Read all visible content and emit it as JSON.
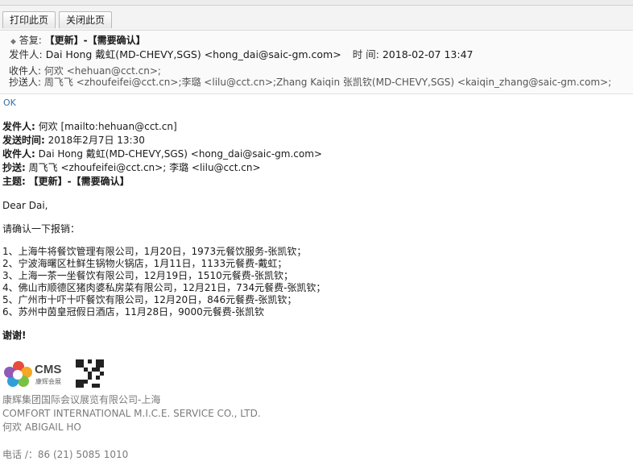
{
  "toolbar": {
    "print_label": "打印此页",
    "close_label": "关闭此页"
  },
  "header": {
    "subject_label": "答复:",
    "subject_value": "【更新】-【需要确认】",
    "from_label": "发件人:",
    "from_value": "Dai Hong 戴虹(MD-CHEVY,SGS) <hong_dai@saic-gm.com>",
    "time_label": "时 间:",
    "time_value": "2018-02-07 13:47",
    "to_label": "收件人:",
    "to_value": "何欢 <hehuan@cct.cn>;",
    "cc_label": "抄送人:",
    "cc_value": "周飞飞 <zhoufeifei@cct.cn>;李璐 <lilu@cct.cn>;Zhang Kaiqin 张凯钦(MD-CHEVY,SGS) <kaiqin_zhang@saic-gm.com>;"
  },
  "body": {
    "reply": "OK",
    "quoted": {
      "from_label": "发件人:",
      "from_value": "何欢 [mailto:hehuan@cct.cn]",
      "sent_label": "发送时间:",
      "sent_value": "2018年2月7日 13:30",
      "to_label": "收件人:",
      "to_value": "Dai Hong 戴虹(MD-CHEVY,SGS) <hong_dai@saic-gm.com>",
      "cc_label": "抄送:",
      "cc_value": "周飞飞 <zhoufeifei@cct.cn>; 李璐 <lilu@cct.cn>",
      "subject_label": "主题:",
      "subject_value": "【更新】-【需要确认】"
    },
    "greeting": "Dear Dai,",
    "request": "请确认一下报销：",
    "items": [
      "1、上海牛将餐饮管理有限公司，1月20日，1973元餐饮服务-张凯钦；",
      "2、宁波海曙区杜鲜生锅物火锅店，1月11日，1133元餐费-戴虹；",
      "3、上海一茶一坐餐饮有限公司，12月19日，1510元餐费-张凯钦；",
      "4、佛山市顺德区猪肉婆私房菜有限公司，12月21日，734元餐费-张凯钦；",
      "5、广州市十吓十吓餐饮有限公司，12月20日，846元餐费-张凯钦；",
      "6、苏州中茵皇冠假日酒店，11月28日，9000元餐费-张凯钦"
    ],
    "thanks": "谢谢!"
  },
  "signature": {
    "logo_text": "CMS",
    "logo_sub": "康辉会展",
    "company_cn": "康辉集团国际会议展览有限公司-上海",
    "company_en": "COMFORT INTERNATIONAL M.I.C.E. SERVICE CO., LTD.",
    "name": "何欢 ABIGAIL HO",
    "phone": "电话 /：86 (21) 5085 1010"
  }
}
